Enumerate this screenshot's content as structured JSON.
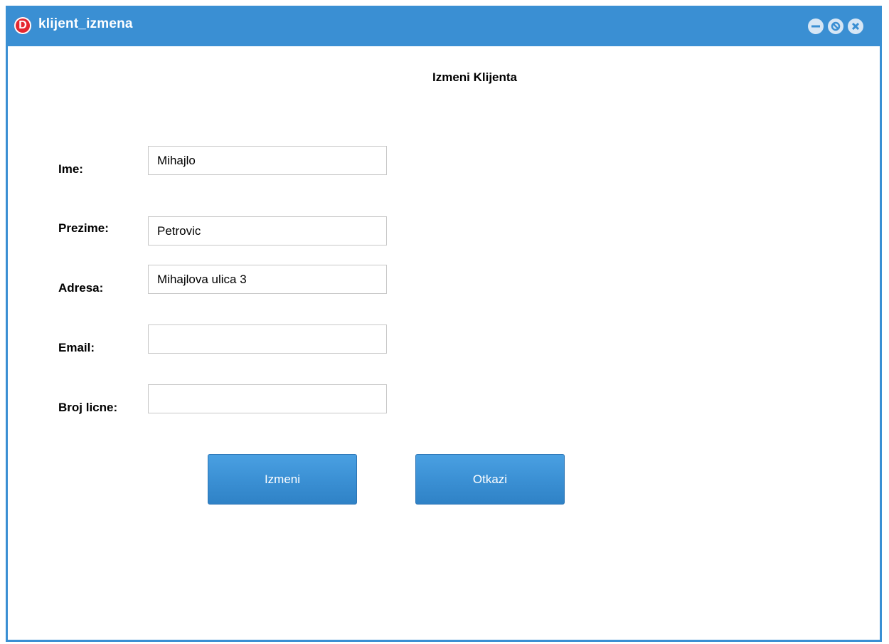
{
  "window": {
    "title": "klijent_izmena",
    "logo_letter": "D",
    "accent_color": "#3a8fd3"
  },
  "form": {
    "heading": "Izmeni Klijenta",
    "fields": {
      "ime": {
        "label": "Ime:",
        "value": "Mihajlo"
      },
      "prezime": {
        "label": "Prezime:",
        "value": "Petrovic"
      },
      "adresa": {
        "label": "Adresa:",
        "value": "Mihajlova ulica 3"
      },
      "email": {
        "label": "Email:",
        "value": ""
      },
      "broj_licne": {
        "label": "Broj licne:",
        "value": ""
      }
    }
  },
  "buttons": {
    "izmeni": "Izmeni",
    "otkazi": "Otkazi"
  }
}
